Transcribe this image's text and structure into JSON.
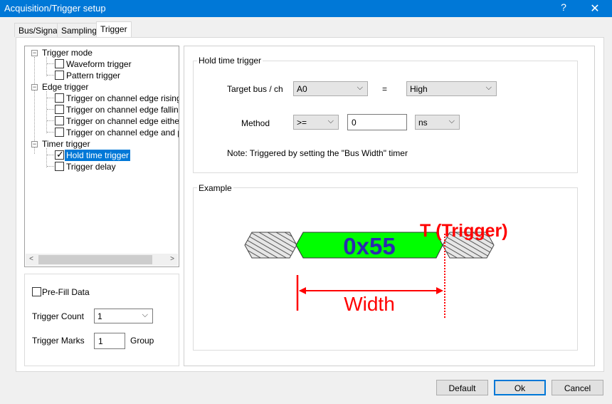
{
  "window": {
    "title": "Acquisition/Trigger setup",
    "help_icon": "?",
    "close_icon": "✕"
  },
  "tabs": [
    {
      "label": "Bus/Signal"
    },
    {
      "label": "Sampling"
    },
    {
      "label": "Trigger",
      "active": true
    }
  ],
  "tree": {
    "items": [
      {
        "label": "Trigger mode"
      },
      {
        "label": "Waveform trigger",
        "checked": false
      },
      {
        "label": "Pattern trigger",
        "checked": false
      },
      {
        "label": "Edge trigger"
      },
      {
        "label": "Trigger on channel edge rising",
        "checked": false
      },
      {
        "label": "Trigger on channel edge falling",
        "checked": false
      },
      {
        "label": "Trigger on channel edge either",
        "checked": false
      },
      {
        "label": "Trigger on channel edge and patt",
        "checked": false
      },
      {
        "label": "Timer trigger"
      },
      {
        "label": "Hold time trigger",
        "checked": true,
        "selected": true
      },
      {
        "label": "Trigger delay",
        "checked": false
      }
    ],
    "expander_symbol": "−",
    "scroll_left": "<",
    "scroll_right": ">"
  },
  "lower": {
    "prefill_label": "Pre-Fill Data",
    "prefill_checked": false,
    "trigger_count_label": "Trigger Count",
    "trigger_count_value": "1",
    "trigger_marks_label": "Trigger Marks",
    "trigger_marks_value": "1",
    "group_label": "Group"
  },
  "hold": {
    "group_title": "Hold time trigger",
    "target_label": "Target bus / ch",
    "target_value": "A0",
    "equals": "=",
    "level_value": "High",
    "method_label": "Method",
    "method_value": ">=",
    "time_value": "0",
    "unit_value": "ns",
    "note": "Note: Triggered by setting the \"Bus Width\" timer"
  },
  "example": {
    "group_title": "Example",
    "data_label": "0x55",
    "trigger_label": "T (Trigger)",
    "width_label": "Width",
    "colors": {
      "data_fill": "#00ff00",
      "data_text": "#2b2bb0",
      "annotation": "#ff0000",
      "hatch": "#9a9a9a"
    }
  },
  "buttons": {
    "default": "Default",
    "ok": "Ok",
    "cancel": "Cancel"
  }
}
